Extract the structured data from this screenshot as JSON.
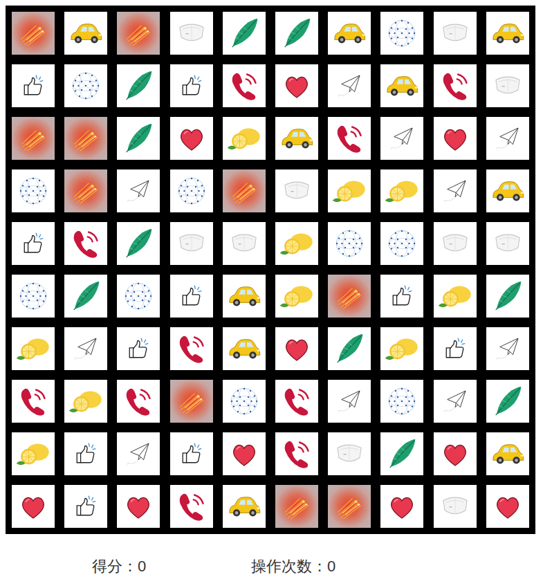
{
  "board": {
    "rows": [
      [
        {
          "kind": "fire"
        },
        {
          "kind": "car"
        },
        {
          "kind": "fire"
        },
        {
          "kind": "mask"
        },
        {
          "kind": "feather"
        },
        {
          "kind": "feather"
        },
        {
          "kind": "car"
        },
        {
          "kind": "globe"
        },
        {
          "kind": "mask"
        },
        {
          "kind": "car"
        }
      ],
      [
        {
          "kind": "thumb"
        },
        {
          "kind": "globe"
        },
        {
          "kind": "feather"
        },
        {
          "kind": "thumb"
        },
        {
          "kind": "phone"
        },
        {
          "kind": "heart"
        },
        {
          "kind": "plane"
        },
        {
          "kind": "car"
        },
        {
          "kind": "phone"
        },
        {
          "kind": "mask"
        }
      ],
      [
        {
          "kind": "fire"
        },
        {
          "kind": "fire"
        },
        {
          "kind": "feather"
        },
        {
          "kind": "heart"
        },
        {
          "kind": "lemon"
        },
        {
          "kind": "car"
        },
        {
          "kind": "phone"
        },
        {
          "kind": "plane"
        },
        {
          "kind": "heart"
        },
        {
          "kind": "plane"
        }
      ],
      [
        {
          "kind": "globe"
        },
        {
          "kind": "fire"
        },
        {
          "kind": "plane"
        },
        {
          "kind": "globe"
        },
        {
          "kind": "fire"
        },
        {
          "kind": "mask"
        },
        {
          "kind": "lemon"
        },
        {
          "kind": "lemon"
        },
        {
          "kind": "plane"
        },
        {
          "kind": "car"
        }
      ],
      [
        {
          "kind": "thumb"
        },
        {
          "kind": "phone"
        },
        {
          "kind": "feather"
        },
        {
          "kind": "mask"
        },
        {
          "kind": "mask"
        },
        {
          "kind": "lemon"
        },
        {
          "kind": "globe"
        },
        {
          "kind": "globe"
        },
        {
          "kind": "mask"
        },
        {
          "kind": "mask"
        }
      ],
      [
        {
          "kind": "globe"
        },
        {
          "kind": "feather"
        },
        {
          "kind": "globe"
        },
        {
          "kind": "thumb"
        },
        {
          "kind": "car"
        },
        {
          "kind": "lemon"
        },
        {
          "kind": "fire"
        },
        {
          "kind": "thumb"
        },
        {
          "kind": "lemon"
        },
        {
          "kind": "feather"
        }
      ],
      [
        {
          "kind": "lemon"
        },
        {
          "kind": "plane"
        },
        {
          "kind": "thumb"
        },
        {
          "kind": "phone"
        },
        {
          "kind": "car"
        },
        {
          "kind": "heart"
        },
        {
          "kind": "feather"
        },
        {
          "kind": "lemon"
        },
        {
          "kind": "thumb"
        },
        {
          "kind": "plane"
        }
      ],
      [
        {
          "kind": "phone"
        },
        {
          "kind": "lemon"
        },
        {
          "kind": "phone"
        },
        {
          "kind": "fire"
        },
        {
          "kind": "globe"
        },
        {
          "kind": "phone"
        },
        {
          "kind": "plane"
        },
        {
          "kind": "globe"
        },
        {
          "kind": "plane"
        },
        {
          "kind": "feather"
        }
      ],
      [
        {
          "kind": "lemon"
        },
        {
          "kind": "thumb"
        },
        {
          "kind": "plane"
        },
        {
          "kind": "thumb"
        },
        {
          "kind": "heart"
        },
        {
          "kind": "phone"
        },
        {
          "kind": "mask"
        },
        {
          "kind": "feather"
        },
        {
          "kind": "heart"
        },
        {
          "kind": "car"
        }
      ],
      [
        {
          "kind": "heart"
        },
        {
          "kind": "thumb"
        },
        {
          "kind": "heart"
        },
        {
          "kind": "phone"
        },
        {
          "kind": "car"
        },
        {
          "kind": "fire"
        },
        {
          "kind": "fire"
        },
        {
          "kind": "heart"
        },
        {
          "kind": "mask"
        },
        {
          "kind": "heart"
        }
      ]
    ]
  },
  "status": {
    "score": "得分：0",
    "moves": "操作次数：0"
  }
}
